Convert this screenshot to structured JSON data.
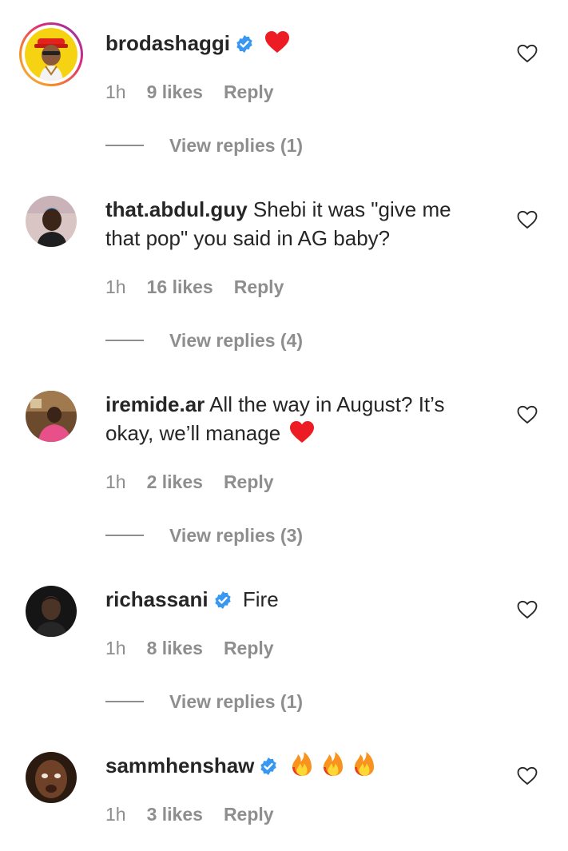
{
  "comments": [
    {
      "username": "brodashaggi",
      "verified": true,
      "text": "",
      "emoji": "heart-red",
      "time": "1h",
      "likes": "9 likes",
      "reply": "Reply",
      "view_replies": "View replies (1)"
    },
    {
      "username": "that.abdul.guy",
      "verified": false,
      "text_line1": "Shebi it was \"give me",
      "text_line2": "that pop\" you said in AG baby?",
      "time": "1h",
      "likes": "16 likes",
      "reply": "Reply",
      "view_replies": "View replies (4)"
    },
    {
      "username": "iremide.ar",
      "verified": false,
      "text_line1": "All the way in August? It’s",
      "text_line2": "okay, we’ll manage",
      "emoji": "heart-red",
      "time": "1h",
      "likes": "2 likes",
      "reply": "Reply",
      "view_replies": "View replies (3)"
    },
    {
      "username": "richassani",
      "verified": true,
      "text": "Fire",
      "time": "1h",
      "likes": "8 likes",
      "reply": "Reply",
      "view_replies": "View replies (1)"
    },
    {
      "username": "sammhenshaw",
      "verified": true,
      "text": "",
      "emoji": "fire x3",
      "time": "1h",
      "likes": "3 likes",
      "reply": "Reply"
    }
  ],
  "icons": {
    "like": "heart-outline-icon",
    "verified": "verified-badge-icon"
  },
  "colors": {
    "text": "#262626",
    "secondary": "#8e8e8e",
    "verified_blue": "#3897f0",
    "heart_red": "#ed1c24"
  }
}
